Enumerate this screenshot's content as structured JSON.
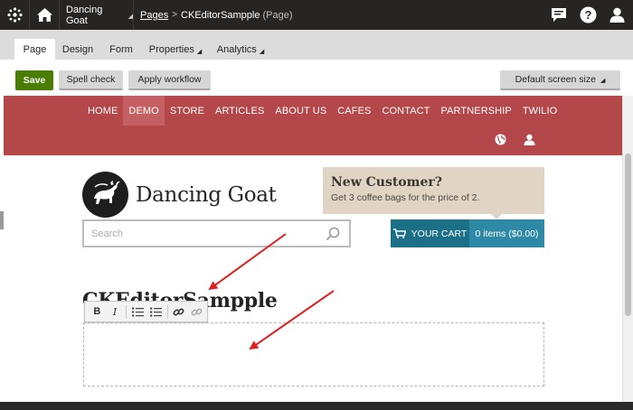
{
  "topbar": {
    "site_name": "Dancing Goat",
    "breadcrumb_root": "Pages",
    "breadcrumb_page": "CKEditorSampple",
    "breadcrumb_kind": "(Page)"
  },
  "tabs": [
    {
      "label": "Page"
    },
    {
      "label": "Design"
    },
    {
      "label": "Form"
    },
    {
      "label": "Properties"
    },
    {
      "label": "Analytics"
    }
  ],
  "toolbar": {
    "save_label": "Save",
    "spell_check_label": "Spell check",
    "apply_workflow_label": "Apply workflow",
    "screen_size_label": "Default screen size"
  },
  "site": {
    "nav": [
      "HOME",
      "DEMO",
      "STORE",
      "ARTICLES",
      "ABOUT US",
      "CAFES",
      "CONTACT",
      "PARTNERSHIP",
      "TWILIO"
    ],
    "active_nav": "DEMO",
    "brand_name": "Dancing Goat",
    "promo_title": "New Customer?",
    "promo_text": "Get 3 coffee bags for the price of 2.",
    "search_placeholder": "Search",
    "cart_label": "YOUR CART",
    "cart_count": "0 items ($0.00)",
    "page_heading": "CKEditorSampple"
  },
  "editor_toolbar": [
    "B",
    "I"
  ],
  "colors": {
    "topbar": "#262524",
    "save_green": "#497d04",
    "header_red": "#b3474a",
    "cart_dark": "#1b6f87",
    "cart_light": "#2d89a5",
    "promo_bg": "#e0d5c5",
    "arrow": "#e02020"
  }
}
